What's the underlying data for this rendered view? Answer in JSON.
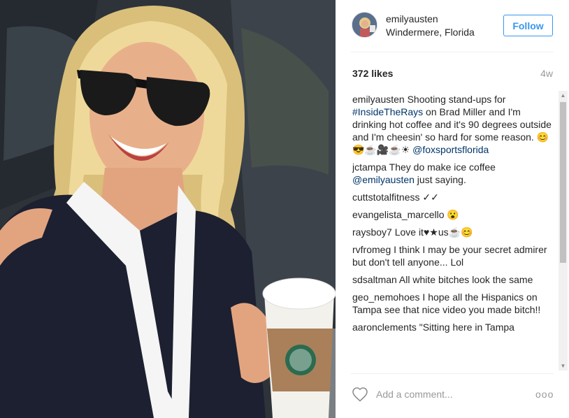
{
  "post": {
    "username": "emilyausten",
    "location": "Windermere, Florida",
    "follow_label": "Follow",
    "likes": "372 likes",
    "age": "4w",
    "photo_alt": "Selfie of woman in sunglasses holding coffee cup"
  },
  "caption": {
    "user": "emilyausten",
    "text_before_tag": " Shooting stand-ups for ",
    "tag1": "#InsideTheRays",
    "text_after_tag": " on Brad Miller and I'm drinking hot coffee and it's 90 degrees outside and I'm cheesin' so hard for some reason. 😊😎☕🎥☕☀",
    "mention": "@foxsportsflorida"
  },
  "comments": [
    {
      "user": "jctampa",
      "text": " They do make ice coffee ",
      "mention": "@emilyausten",
      "text2": " just saying."
    },
    {
      "user": "cuttstotalfitness",
      "text": " ✓✓",
      "mention": "",
      "text2": ""
    },
    {
      "user": "evangelista_marcello",
      "text": " 😮",
      "mention": "",
      "text2": ""
    },
    {
      "user": "raysboy7",
      "text": " Love it♥★us☕😊",
      "mention": "",
      "text2": ""
    },
    {
      "user": "rvfromeg",
      "text": " I think I may be your secret admirer but don't tell anyone... Lol",
      "mention": "",
      "text2": ""
    },
    {
      "user": "sdsaltman",
      "text": " All white bitches look the same",
      "mention": "",
      "text2": ""
    },
    {
      "user": "geo_nemohoes",
      "text": " I hope all the Hispanics on Tampa see that nice video you made bitch!!",
      "mention": "",
      "text2": ""
    },
    {
      "user": "aaronclements",
      "text": " \"Sitting here in Tampa",
      "mention": "",
      "text2": ""
    }
  ],
  "footer": {
    "comment_placeholder": "Add a comment...",
    "more_label": "ooo"
  },
  "icons": {
    "heart": "heart-icon",
    "more": "more-options-icon"
  },
  "colors": {
    "accent": "#3897f0",
    "link": "#003569"
  }
}
